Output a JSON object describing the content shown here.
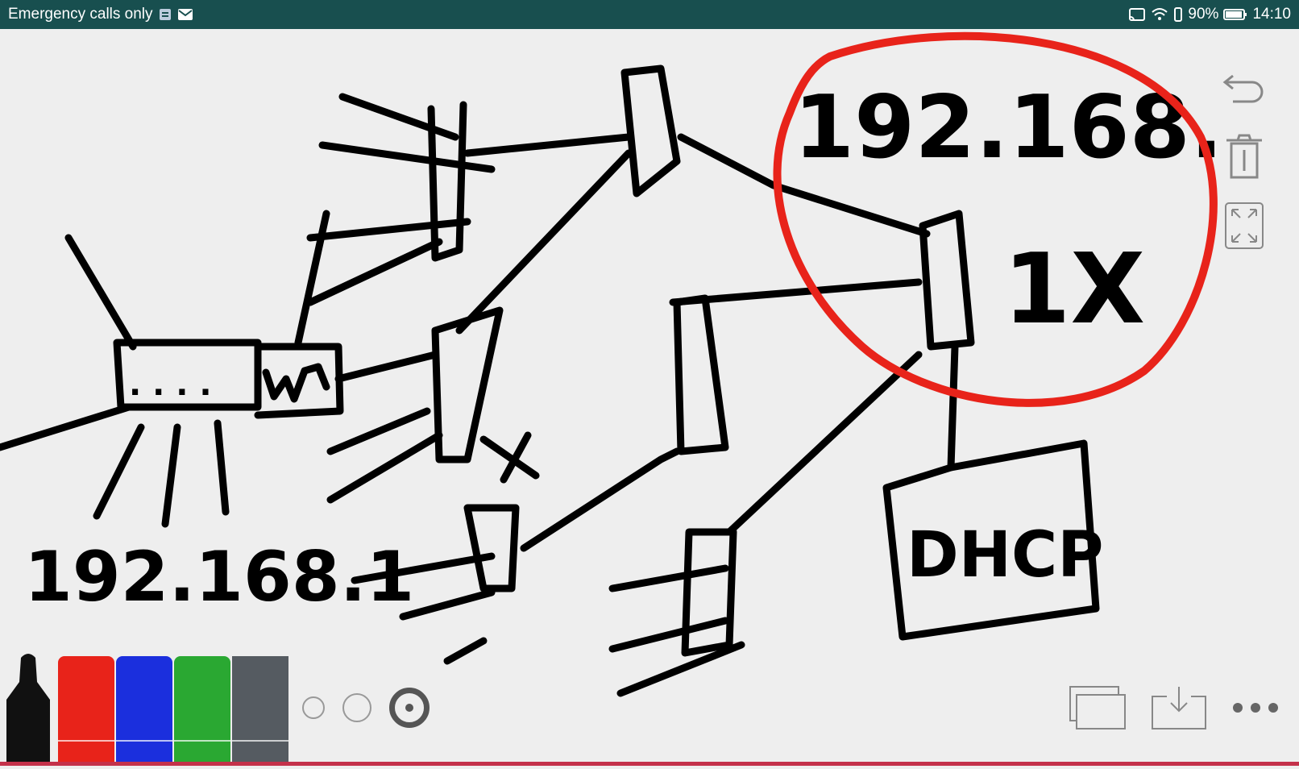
{
  "statusbar": {
    "left_text": "Emergency calls only",
    "battery": "90%",
    "time": "14:10",
    "bg_color": "#184f4f"
  },
  "drawing": {
    "ink_color": "#000000",
    "highlight_color": "#e8231a",
    "texts": [
      "192.168.",
      "1X",
      "W",
      ". . . .",
      "192.168.1",
      "DHCP"
    ]
  },
  "side_tools": [
    "undo-icon",
    "trash-icon",
    "fullscreen-icon"
  ],
  "palette": {
    "pen": "marker",
    "colors": [
      "#e8231a",
      "#1b2fdd",
      "#2aa832",
      "#555b61"
    ]
  },
  "pen_sizes": [
    "small",
    "medium",
    "large"
  ],
  "bottom_tools": [
    "pages-icon",
    "save-icon",
    "more-icon"
  ]
}
